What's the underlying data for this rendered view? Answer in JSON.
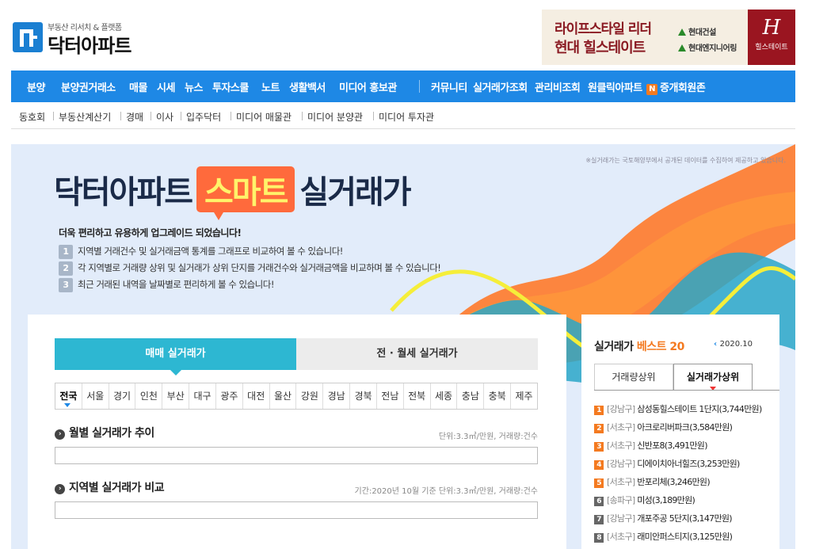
{
  "logo": {
    "tagline": "부동산 리서치 & 플랫폼",
    "name": "닥터아파트"
  },
  "ad": {
    "line1": "라이프스타일 리더",
    "line2": "현대 힐스테이트",
    "brand1": "현대건설",
    "brand2": "현대엔지니어링",
    "hill_mark": "H",
    "hill_name": "힐스테이트"
  },
  "nav": {
    "main": [
      "분양",
      "분양권거래소",
      "매물",
      "시세",
      "뉴스",
      "투자스쿨",
      "노트",
      "생활백서",
      "미디어 홍보관"
    ],
    "right": [
      "커뮤니티",
      "실거래가조회",
      "관리비조회",
      "원클릭아파트",
      "증개회원존"
    ],
    "badge": "N"
  },
  "subnav": [
    "동호회",
    "부동산계산기",
    "경매",
    "이사",
    "입주닥터",
    "미디어 매물관",
    "미디어 분양관",
    "미디어 투자관"
  ],
  "banner": {
    "notice": "※실거래가는 국토해양부에서 공개된 데이터를 수집하여 제공하고 있습니다.",
    "title_a": "닥터아파트",
    "title_smart": "스마트",
    "title_b": "실거래가",
    "subtitle": "더욱 편리하고 유용하게 업그레이드 되었습니다!",
    "items": [
      {
        "n": "1",
        "text": "지역별 거래건수 및 실거래금액 통계를 그래프로 비교하여 볼 수 있습니다!"
      },
      {
        "n": "2",
        "text": "각 지역별로 거래량 상위 및 실거래가 상위 단지를 거래건수와 실거래금액을 비교하며 볼 수 있습니다!"
      },
      {
        "n": "3",
        "text": "최근 거래된 내역을 날짜별로 편리하게 볼 수 있습니다!"
      }
    ]
  },
  "tabs": {
    "sale": "매매 실거래가",
    "rent": "전 · 월세 실거래가"
  },
  "regions": [
    "전국",
    "서울",
    "경기",
    "인천",
    "부산",
    "대구",
    "광주",
    "대전",
    "울산",
    "강원",
    "경남",
    "경북",
    "전남",
    "전북",
    "세종",
    "충남",
    "충북",
    "제주"
  ],
  "section1": {
    "title": "월별 실거래가 추이",
    "unit": "단위:3.3㎡/만원, 거래량:건수"
  },
  "section2": {
    "title": "지역별 실거래가 비교",
    "unit": "기간:2020년 10월 기준 단위:3.3㎡/만원, 거래량:건수"
  },
  "best": {
    "title": "실거래가",
    "title_accent": "베스트 20",
    "date": "2020.10",
    "tab_volume": "거래량상위",
    "tab_price": "실거래가상위",
    "items": [
      {
        "rank": "1",
        "area": "[강남구]",
        "name": "삼성동힐스테이트 1단지(3,744만원)"
      },
      {
        "rank": "2",
        "area": "[서초구]",
        "name": "아크로리버파크(3,584만원)"
      },
      {
        "rank": "3",
        "area": "[서초구]",
        "name": "신반포8(3,491만원)"
      },
      {
        "rank": "4",
        "area": "[강남구]",
        "name": "디에이치아너힐즈(3,253만원)"
      },
      {
        "rank": "5",
        "area": "[서초구]",
        "name": "반포리체(3,246만원)"
      },
      {
        "rank": "6",
        "area": "[송파구]",
        "name": "미성(3,189만원)"
      },
      {
        "rank": "7",
        "area": "[강남구]",
        "name": "개포주공 5단지(3,147만원)"
      },
      {
        "rank": "8",
        "area": "[서초구]",
        "name": "래미안퍼스티지(3,125만원)"
      }
    ]
  },
  "colors": {
    "nav": "#1e88e5",
    "tab_active": "#2db7d2",
    "accent": "#f47a20",
    "banner_bg": "#e2ecfa"
  }
}
